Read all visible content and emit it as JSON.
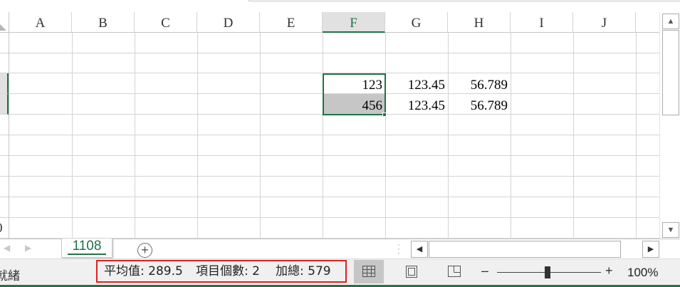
{
  "columns": [
    "A",
    "B",
    "C",
    "D",
    "E",
    "F",
    "G",
    "H",
    "I",
    "J"
  ],
  "active_column": "F",
  "cells": {
    "F4": "123",
    "G4": "123.45",
    "H4": "56.789",
    "F5": "456",
    "G5": "123.45",
    "H5": "56.789"
  },
  "row_header_partial_label": "0",
  "sheet_tab": {
    "name": "1108"
  },
  "add_sheet_label": "+",
  "status": {
    "ready": "就緒",
    "average": "平均值: 289.5",
    "count": "項目個數: 2",
    "sum": "加總: 579"
  },
  "zoom": {
    "minus": "–",
    "plus": "+",
    "level": "100%",
    "fraction": 0.5
  },
  "icons": {
    "scroll_up": "▲",
    "scroll_down": "▼",
    "scroll_left": "◀",
    "scroll_right": "▶",
    "tab_prev": "◀",
    "tab_next": "▶"
  },
  "colors": {
    "accent": "#217346",
    "highlight_box": "#e02020",
    "selection_fill": "#c6c6c6"
  }
}
